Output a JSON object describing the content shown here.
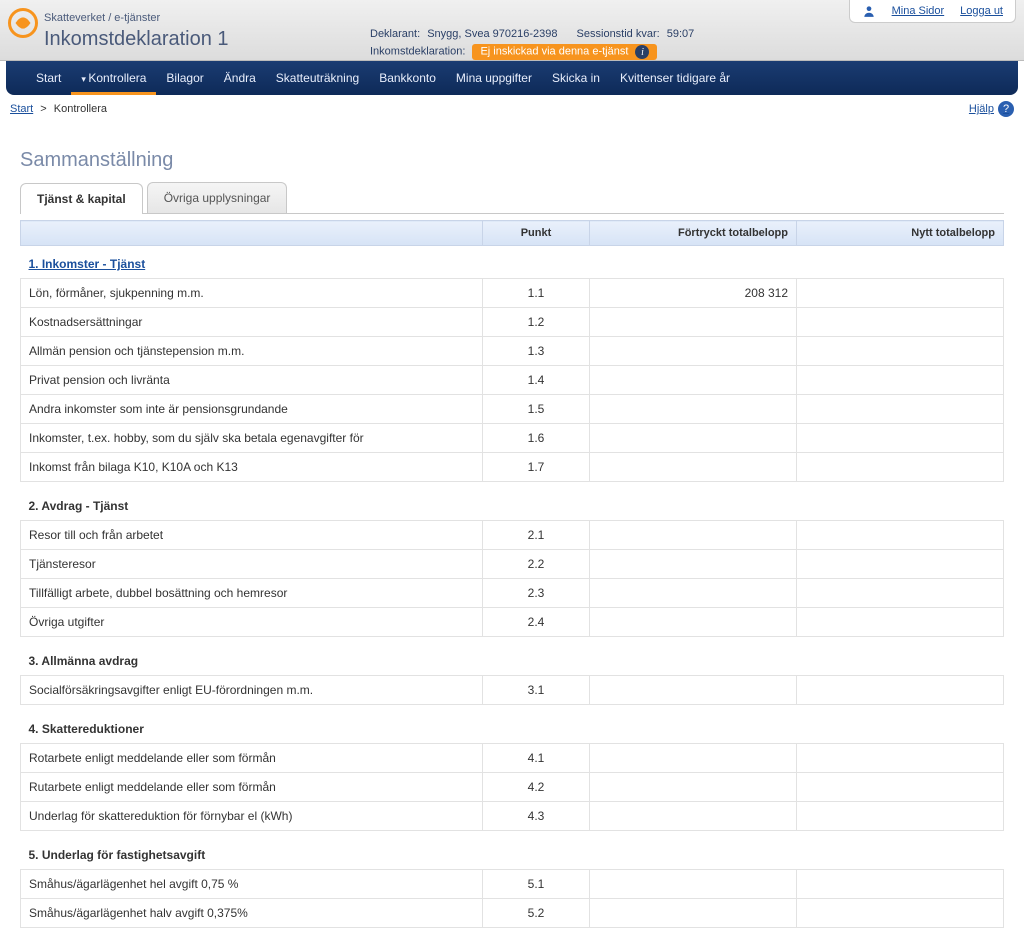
{
  "header": {
    "agency_line": "Skatteverket / e-tjänster",
    "app_title": "Inkomstdeklaration 1",
    "declarant_label": "Deklarant:",
    "declarant_value": "Snygg, Svea 970216-2398",
    "session_label": "Sessionstid kvar:",
    "session_value": "59:07",
    "submission_label": "Inkomstdeklaration:",
    "submission_status": "Ej inskickad via denna e-tjänst",
    "mina_sidor": "Mina Sidor",
    "logout": "Logga ut"
  },
  "nav": {
    "items": [
      {
        "label": "Start",
        "active": false,
        "caret": false
      },
      {
        "label": "Kontrollera",
        "active": true,
        "caret": true
      },
      {
        "label": "Bilagor",
        "active": false,
        "caret": false
      },
      {
        "label": "Ändra",
        "active": false,
        "caret": false
      },
      {
        "label": "Skatteuträkning",
        "active": false,
        "caret": false
      },
      {
        "label": "Bankkonto",
        "active": false,
        "caret": false
      },
      {
        "label": "Mina uppgifter",
        "active": false,
        "caret": false
      },
      {
        "label": "Skicka in",
        "active": false,
        "caret": false
      },
      {
        "label": "Kvittenser tidigare år",
        "active": false,
        "caret": false
      }
    ]
  },
  "breadcrumb": {
    "start": "Start",
    "sep": ">",
    "current": "Kontrollera",
    "help": "Hjälp"
  },
  "page_title": "Sammanställning",
  "tabs": [
    {
      "label": "Tjänst & kapital",
      "active": true
    },
    {
      "label": "Övriga upplysningar",
      "active": false
    }
  ],
  "table": {
    "headers": {
      "c1": "",
      "c2": "Punkt",
      "c3": "Förtryckt totalbelopp",
      "c4": "Nytt totalbelopp"
    },
    "sections": [
      {
        "title": "1. Inkomster - Tjänst",
        "link": true,
        "rows": [
          {
            "label": "Lön, förmåner, sjukpenning m.m.",
            "punkt": "1.1",
            "pre": "208 312",
            "ny": ""
          },
          {
            "label": "Kostnadsersättningar",
            "punkt": "1.2",
            "pre": "",
            "ny": ""
          },
          {
            "label": "Allmän pension och tjänstepension m.m.",
            "punkt": "1.3",
            "pre": "",
            "ny": ""
          },
          {
            "label": "Privat pension och livränta",
            "punkt": "1.4",
            "pre": "",
            "ny": ""
          },
          {
            "label": "Andra inkomster som inte är pensionsgrundande",
            "punkt": "1.5",
            "pre": "",
            "ny": ""
          },
          {
            "label": "Inkomster, t.ex. hobby, som du själv ska betala egenavgifter för",
            "punkt": "1.6",
            "pre": "",
            "ny": ""
          },
          {
            "label": "Inkomst från bilaga K10, K10A och K13",
            "punkt": "1.7",
            "pre": "",
            "ny": ""
          }
        ]
      },
      {
        "title": "2. Avdrag - Tjänst",
        "link": false,
        "rows": [
          {
            "label": "Resor till och från arbetet",
            "punkt": "2.1",
            "pre": "",
            "ny": ""
          },
          {
            "label": "Tjänsteresor",
            "punkt": "2.2",
            "pre": "",
            "ny": ""
          },
          {
            "label": "Tillfälligt arbete, dubbel bosättning och hemresor",
            "punkt": "2.3",
            "pre": "",
            "ny": ""
          },
          {
            "label": "Övriga utgifter",
            "punkt": "2.4",
            "pre": "",
            "ny": ""
          }
        ]
      },
      {
        "title": "3. Allmänna avdrag",
        "link": false,
        "rows": [
          {
            "label": "Socialförsäkringsavgifter enligt EU-förordningen m.m.",
            "punkt": "3.1",
            "pre": "",
            "ny": ""
          }
        ]
      },
      {
        "title": "4. Skattereduktioner",
        "link": false,
        "rows": [
          {
            "label": "Rotarbete enligt meddelande eller som förmån",
            "punkt": "4.1",
            "pre": "",
            "ny": ""
          },
          {
            "label": "Rutarbete enligt meddelande eller som förmån",
            "punkt": "4.2",
            "pre": "",
            "ny": ""
          },
          {
            "label": "Underlag för skattereduktion för förnybar el (kWh)",
            "punkt": "4.3",
            "pre": "",
            "ny": ""
          }
        ]
      },
      {
        "title": "5. Underlag för fastighetsavgift",
        "link": false,
        "rows": [
          {
            "label": "Småhus/ägarlägenhet hel avgift 0,75 %",
            "punkt": "5.1",
            "pre": "",
            "ny": ""
          },
          {
            "label": "Småhus/ägarlägenhet halv avgift 0,375%",
            "punkt": "5.2",
            "pre": "",
            "ny": ""
          }
        ]
      }
    ]
  }
}
